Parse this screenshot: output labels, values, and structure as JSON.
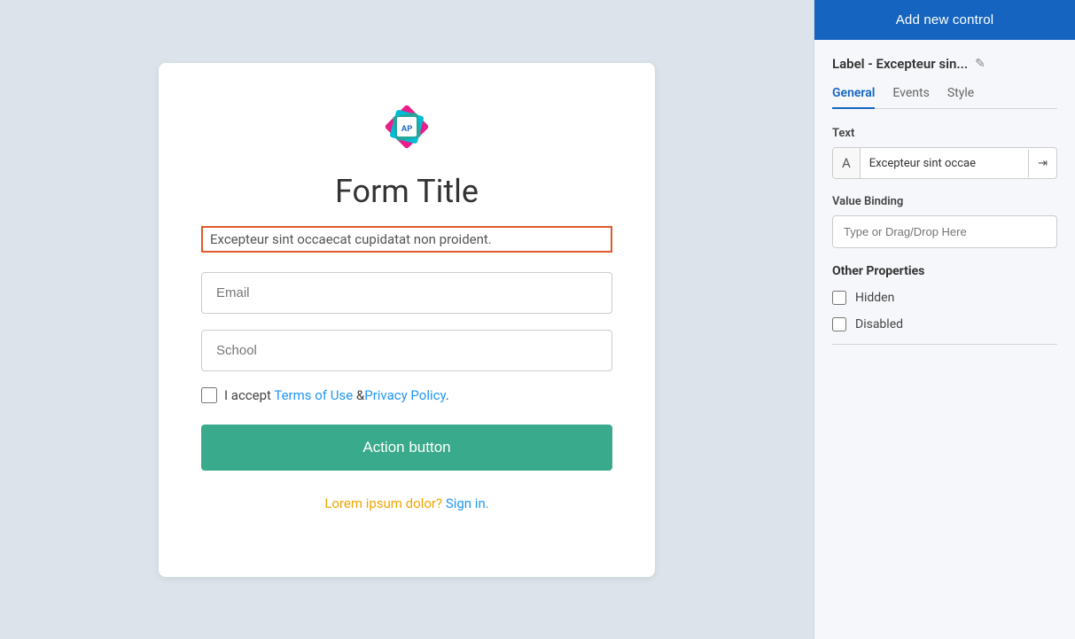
{
  "main": {
    "form": {
      "title": "Form Title",
      "label_text": "Excepteur sint occaecat cupidatat non proident.",
      "email_placeholder": "Email",
      "school_placeholder": "School",
      "checkbox_text_before": "I accept ",
      "checkbox_link1": "Terms of Use",
      "checkbox_between": " &",
      "checkbox_link2": "Privacy Policy",
      "checkbox_period": ".",
      "action_button": "Action button",
      "bottom_text_colored": "Lorem ipsum dolor?",
      "bottom_link": "Sign in."
    }
  },
  "right_panel": {
    "add_button": "Add new control",
    "label_header": "Label - Excepteur sin...",
    "tabs": [
      {
        "label": "General",
        "active": true
      },
      {
        "label": "Events",
        "active": false
      },
      {
        "label": "Style",
        "active": false
      }
    ],
    "text_section_label": "Text",
    "text_value": "Excepteur sint occae",
    "text_icon": "A",
    "value_binding_label": "Value Binding",
    "value_binding_placeholder": "Type or Drag/Drop Here",
    "other_properties_label": "Other Properties",
    "hidden_label": "Hidden",
    "disabled_label": "Disabled"
  },
  "logo": {
    "initials": "AP"
  }
}
